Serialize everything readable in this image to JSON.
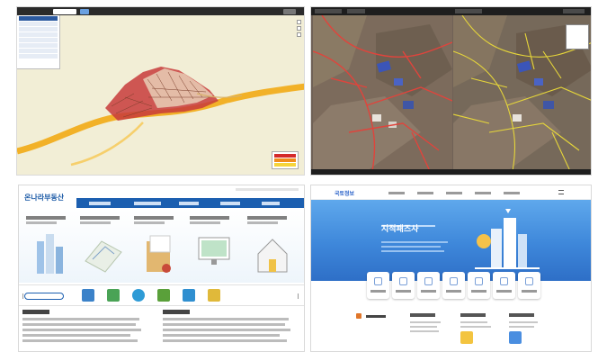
{
  "panels": {
    "gis_overview": {
      "legend_colors": [
        "#d42a2a",
        "#f08c1c",
        "#f6d43a"
      ],
      "road_color": "#f2b128",
      "area_color": "#c83b3b"
    },
    "aerial_compare": {
      "left_boundary_color": "#e0443c",
      "right_boundary_color": "#e6d63a"
    },
    "portal_site": {
      "logo": "온나라부동산",
      "accent": "#1c5fb0",
      "menu_items": [
        "",
        "",
        "",
        "",
        ""
      ],
      "quick_link_colors": [
        "#3b82c9",
        "#4aa356",
        "#2e9bd6",
        "#5aa03a",
        "#2f8fd0",
        "#e0b93a"
      ]
    },
    "cadastral_site": {
      "logo": "국토정보",
      "hero_title": "지적패즈사",
      "accent": "#2a62c9",
      "service_count": 7
    }
  }
}
